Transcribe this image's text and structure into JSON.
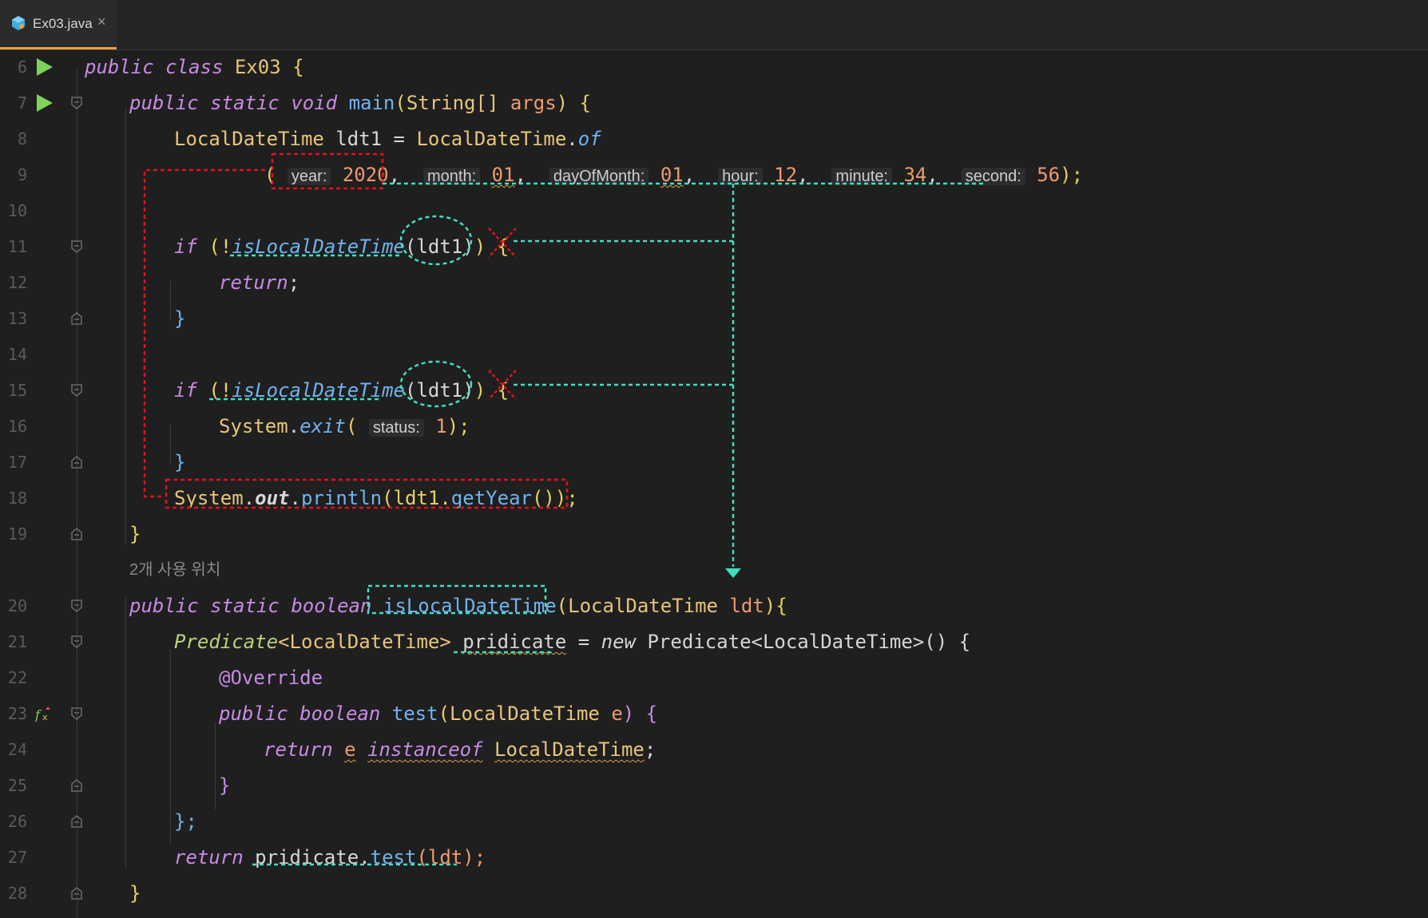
{
  "tab": {
    "filename": "Ex03.java",
    "close": "×"
  },
  "usage_lens": "2개 사용 위치",
  "line_numbers": [
    "6",
    "7",
    "8",
    "9",
    "10",
    "11",
    "12",
    "13",
    "14",
    "15",
    "16",
    "17",
    "18",
    "19",
    "20",
    "21",
    "22",
    "23",
    "24",
    "25",
    "26",
    "27",
    "28"
  ],
  "code": {
    "l6": {
      "kw1": "public",
      "kw2": "class",
      "cls": "Ex03",
      "rest": " {"
    },
    "l7": {
      "kw1": "public",
      "kw2": "static",
      "kw3": "void",
      "fn": "main",
      "p1": "(",
      "type": "String[]",
      "arg": "args",
      "p2": ") {"
    },
    "l8": {
      "type": "LocalDateTime",
      "var": "ldt1",
      "eq": " = ",
      "cls": "LocalDateTime",
      "dot": ".",
      "fn": "of"
    },
    "l9": {
      "open": "(",
      "h_year": "year:",
      "v_year": "2020",
      "h_month": "month:",
      "v_month": "01",
      "h_day": "dayOfMonth:",
      "v_day": "01",
      "h_hour": "hour:",
      "v_hour": "12",
      "h_min": "minute:",
      "v_min": "34",
      "h_sec": "second:",
      "v_sec": "56",
      "close": ");"
    },
    "l11": {
      "kw": "if",
      "p1": " (!",
      "fn": "isLocalDateTime",
      "arg": "(ldt1)",
      "p2": ") {"
    },
    "l12": {
      "kw": "return",
      "semi": ";"
    },
    "l13": {
      "brace": "}"
    },
    "l15": {
      "kw": "if",
      "p1": " (!",
      "fn": "isLocalDateTime",
      "arg": "(ldt1)",
      "p2": ") {"
    },
    "l16": {
      "cls": "System",
      "dot": ".",
      "fn": "exit",
      "p1": "( ",
      "hint": "status:",
      "num": "1",
      "p2": ");"
    },
    "l17": {
      "brace": "}"
    },
    "l18": {
      "cls": "System",
      "dot1": ".",
      "field": "out",
      "dot2": ".",
      "fn": "println",
      "arg": "(ldt1.",
      "fn2": "getYear",
      "p2": "());"
    },
    "l19": {
      "brace": "}"
    },
    "l20": {
      "kw1": "public",
      "kw2": "static",
      "kw3": "boolean",
      "fn": "isLocalDateTime",
      "p1": "(",
      "type": "LocalDateTime",
      "arg": "ldt",
      "p2": "){"
    },
    "l21": {
      "type": "Predicate",
      "gen": "<LocalDateTime>",
      "var": "pridicate",
      "eq": " = ",
      "kw": "new",
      "ctor": "Predicate<LocalDateTime>() {"
    },
    "l22": {
      "ann": "@Override"
    },
    "l23": {
      "kw1": "public",
      "kw2": "boolean",
      "fn": "test",
      "p1": "(",
      "type": "LocalDateTime",
      "arg": "e",
      "p2": ") {"
    },
    "l24": {
      "kw": "return",
      "arg": "e",
      "kw2": "instanceof",
      "type": "LocalDateTime",
      "semi": ";"
    },
    "l25": {
      "brace": "}"
    },
    "l26": {
      "brace": "};"
    },
    "l27": {
      "kw": "return",
      "var": "pridicate",
      "dot": ".",
      "fn": "test",
      "arg": "(ldt);"
    },
    "l28": {
      "brace": "}"
    }
  },
  "colors": {
    "background": "#1f1f1f",
    "tab_accent": "#e7a43a",
    "keyword": "#c98ae6",
    "class": "#e8c57a",
    "function": "#6fb3f0",
    "number": "#f09a6b",
    "annotation_red": "#e0121b",
    "annotation_teal": "#3fe0c2",
    "run_icon": "#7ed35b"
  }
}
